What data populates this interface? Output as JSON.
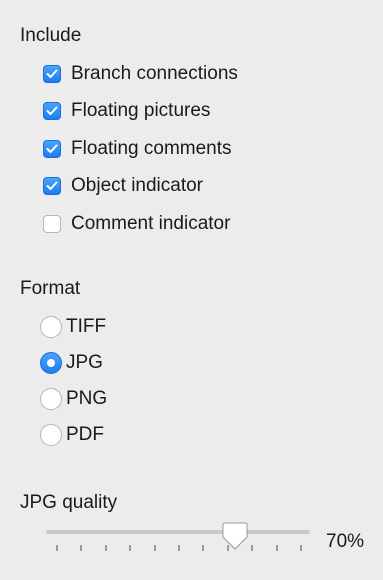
{
  "include": {
    "title": "Include",
    "items": [
      {
        "label": "Branch connections",
        "checked": true
      },
      {
        "label": "Floating pictures",
        "checked": true
      },
      {
        "label": "Floating comments",
        "checked": true
      },
      {
        "label": "Object indicator",
        "checked": true
      },
      {
        "label": "Comment indicator",
        "checked": false
      }
    ]
  },
  "format": {
    "title": "Format",
    "options": [
      {
        "label": "TIFF",
        "selected": false
      },
      {
        "label": "JPG",
        "selected": true
      },
      {
        "label": "PNG",
        "selected": false
      },
      {
        "label": "PDF",
        "selected": false
      }
    ]
  },
  "quality": {
    "title": "JPG quality",
    "value_text": "70%",
    "value": 0.7,
    "tick_count": 11
  },
  "colors": {
    "accent": "#1d7df0",
    "background": "#ececec"
  }
}
